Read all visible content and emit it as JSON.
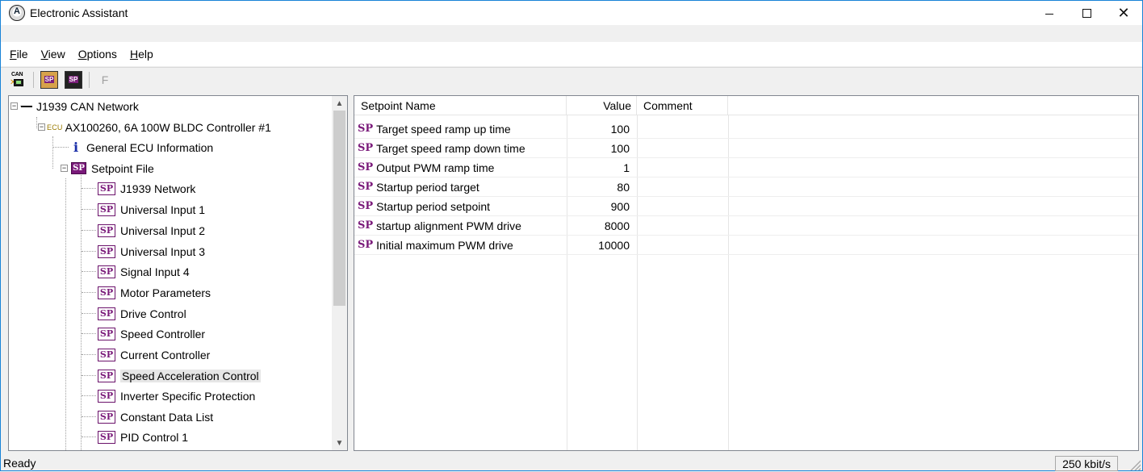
{
  "window": {
    "title": "Electronic Assistant"
  },
  "menu": [
    {
      "label": "File"
    },
    {
      "label": "View"
    },
    {
      "label": "Options"
    },
    {
      "label": "Help"
    }
  ],
  "toolbar": {
    "can_label": "CAN",
    "sp_label": "SP",
    "f_label": "F"
  },
  "tree": {
    "network": "J1939 CAN Network",
    "ecu_prefix": "ECU",
    "ecu": "AX100260, 6A 100W BLDC Controller #1",
    "info": "General ECU Information",
    "info_icon": "i",
    "setpoint_file": "Setpoint File",
    "sp_icon": "SP",
    "items": [
      "J1939 Network",
      "Universal Input 1",
      "Universal Input 2",
      "Universal Input 3",
      "Signal Input 4",
      "Motor Parameters",
      "Drive Control",
      "Speed Controller",
      "Current Controller",
      "Speed Acceleration Control",
      "Inverter Specific Protection",
      "Constant Data List",
      "PID Control 1"
    ],
    "selected_item": "Speed Acceleration Control"
  },
  "list": {
    "headers": {
      "name": "Setpoint Name",
      "value": "Value",
      "comment": "Comment"
    },
    "sp_tag": "SP",
    "rows": [
      {
        "name": "Target speed ramp up time",
        "value": "100"
      },
      {
        "name": "Target speed ramp down time",
        "value": "100"
      },
      {
        "name": "Output PWM ramp time",
        "value": "1"
      },
      {
        "name": "Startup period target",
        "value": "80"
      },
      {
        "name": "Startup period setpoint",
        "value": "900"
      },
      {
        "name": "startup alignment PWM drive",
        "value": "8000"
      },
      {
        "name": "Initial maximum PWM drive",
        "value": "10000"
      }
    ]
  },
  "status": {
    "text": "Ready",
    "baud": "250 kbit/s"
  }
}
